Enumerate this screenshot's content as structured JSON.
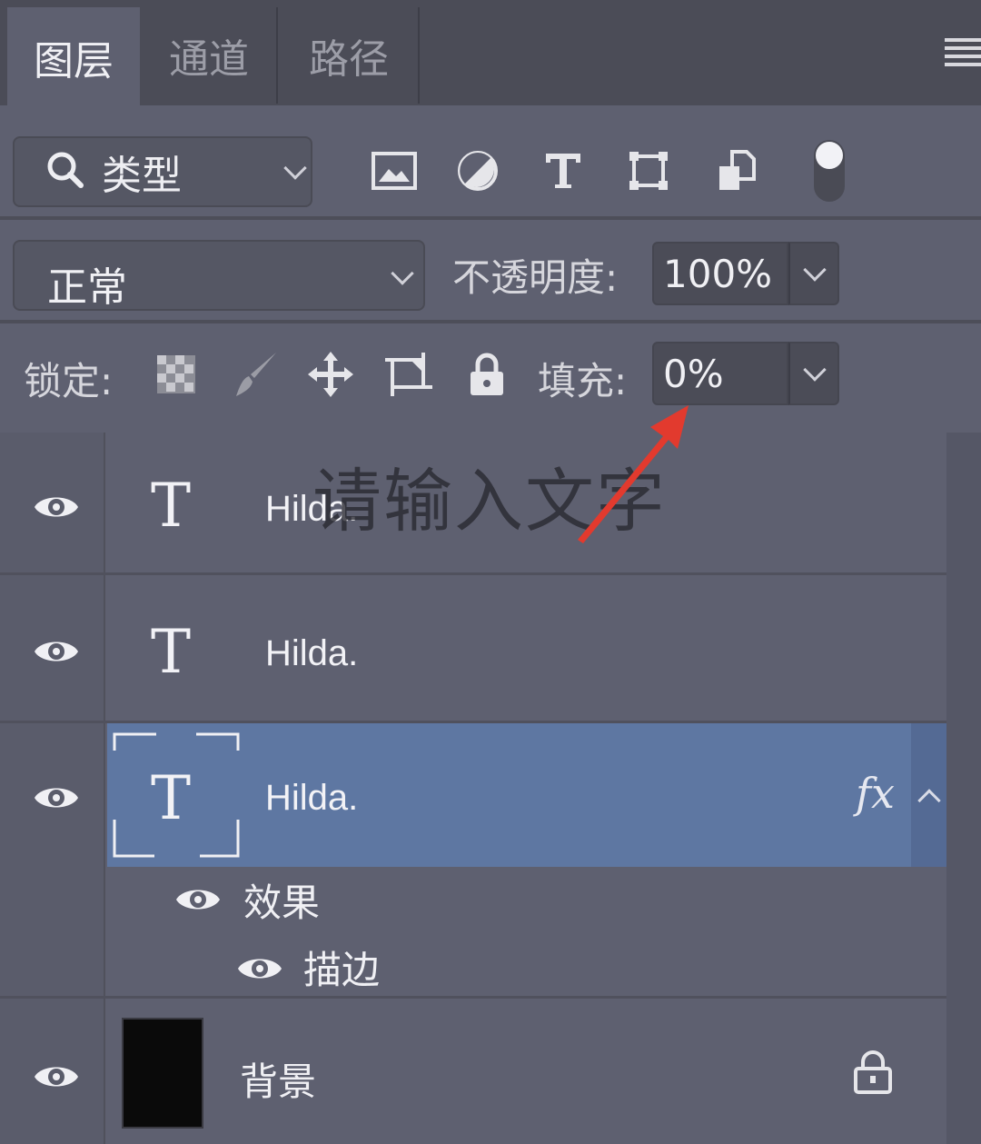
{
  "tabs": [
    {
      "label": "图层",
      "active": true
    },
    {
      "label": "通道",
      "active": false
    },
    {
      "label": "路径",
      "active": false
    }
  ],
  "filter": {
    "kind_label": "类型",
    "icons": [
      "image-filter-icon",
      "adjustment-filter-icon",
      "type-filter-icon",
      "shape-filter-icon",
      "smart-object-filter-icon",
      "filter-toggle"
    ]
  },
  "blend": {
    "mode": "正常",
    "opacity_label": "不透明度:",
    "opacity_value": "100%"
  },
  "lock": {
    "label": "锁定:",
    "fill_label": "填充:",
    "fill_value": "0%"
  },
  "layers": [
    {
      "type": "text",
      "name": "Hilda.",
      "visible": true,
      "selected": false
    },
    {
      "type": "text",
      "name": "Hilda.",
      "visible": true,
      "selected": false
    },
    {
      "type": "text",
      "name": "Hilda.",
      "visible": true,
      "selected": true,
      "fx": "fx"
    }
  ],
  "effects": {
    "label": "效果",
    "stroke_label": "描边"
  },
  "background": {
    "name": "背景",
    "locked": true
  },
  "overlay": {
    "watermark": "请输入文字",
    "arrow_color": "#e23a2e"
  },
  "colors": {
    "panel": "#5e6070",
    "selected_row": "#5e77a2"
  }
}
